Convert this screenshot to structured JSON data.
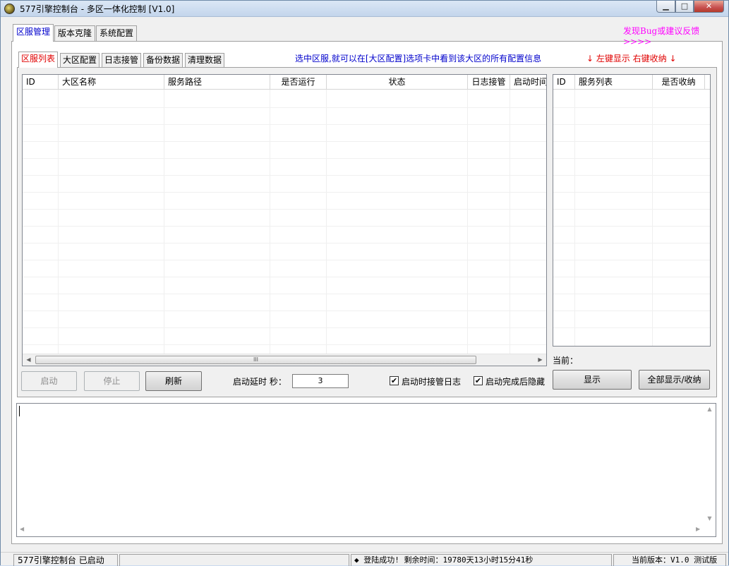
{
  "window": {
    "title": "577引擎控制台 - 多区一体化控制 [V1.0]",
    "min_symbol": "▁",
    "max_symbol": "□",
    "close_symbol": "✕"
  },
  "top_tabs": [
    "区服管理",
    "版本克隆",
    "系统配置"
  ],
  "feedback_link": "发现Bug或建议反馈 >>>>",
  "inner_tabs": [
    "区服列表",
    "大区配置",
    "日志接管",
    "备份数据",
    "清理数据"
  ],
  "hint_blue": "选中区服,就可以在[大区配置]选项卡中看到该大区的所有配置信息",
  "hint_red": "↓  左键显示 右键收纳  ↓",
  "server_table": {
    "columns": [
      "ID",
      "大区名称",
      "服务路径",
      "是否运行",
      "状态",
      "日志接管",
      "启动时间"
    ]
  },
  "service_table": {
    "columns": [
      "ID",
      "服务列表",
      "是否收纳"
    ]
  },
  "scroll": {
    "left": "◀",
    "right": "▶",
    "up": "▲",
    "down": "▼",
    "grip": "III"
  },
  "controls": {
    "start": "启动",
    "stop": "停止",
    "refresh": "刷新",
    "delay_label": "启动延时 秒：",
    "delay_value": "3",
    "take_log_label": "启动时接管日志",
    "take_log_checked": "✔",
    "hide_after_label": "启动完成后隐藏",
    "hide_after_checked": "✔",
    "current_label": "当前：",
    "show": "显示",
    "show_all": "全部显示/收纳"
  },
  "status": {
    "app": "577引擎控制台 已启动",
    "login": "◆ 登陆成功! 剩余时间：19780天13小时15分41秒",
    "version": "当前版本：V1.0 测试版"
  }
}
